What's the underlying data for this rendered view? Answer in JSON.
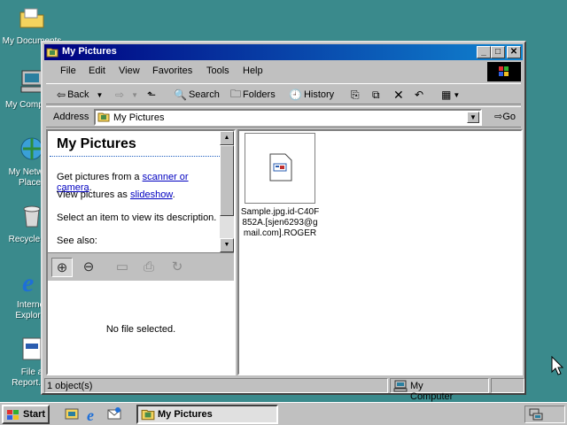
{
  "desktop": {
    "icons": [
      {
        "label": "My Documents"
      },
      {
        "label": "My Computer"
      },
      {
        "label": "My Network Places"
      },
      {
        "label": "Recycle Bin"
      },
      {
        "label": "Internet Explorer"
      },
      {
        "label": "File a Report.lnk"
      }
    ]
  },
  "window": {
    "title": "My Pictures",
    "controls": {
      "minimize": "_",
      "maximize": "□",
      "close": "✕"
    },
    "menu": [
      "File",
      "Edit",
      "View",
      "Favorites",
      "Tools",
      "Help"
    ],
    "toolbar": {
      "back": "Back",
      "search": "Search",
      "folders": "Folders",
      "history": "History"
    },
    "address": {
      "label": "Address",
      "value": "My Pictures",
      "go": "Go"
    }
  },
  "info_pane": {
    "title": "My Pictures",
    "line1_prefix": "Get pictures from a ",
    "line1_link": "scanner or camera",
    "line1_suffix": ".",
    "line2_prefix": "View pictures as ",
    "line2_link": "slideshow",
    "line2_suffix": ".",
    "line3": "Select an item to view its description.",
    "line4": "See also:",
    "no_file": "No file selected."
  },
  "files": [
    {
      "name": "Sample.jpg.id-C40F852A.[sjen6293@gmail.com].ROGER"
    }
  ],
  "status": {
    "objects": "1 object(s)",
    "zone": "My Computer"
  },
  "taskbar": {
    "start": "Start",
    "task": "My Pictures"
  },
  "colors": {
    "desktop": "#3a8a8c",
    "title_start": "#000080",
    "title_end": "#1084d0",
    "face": "#c0c0c0"
  }
}
